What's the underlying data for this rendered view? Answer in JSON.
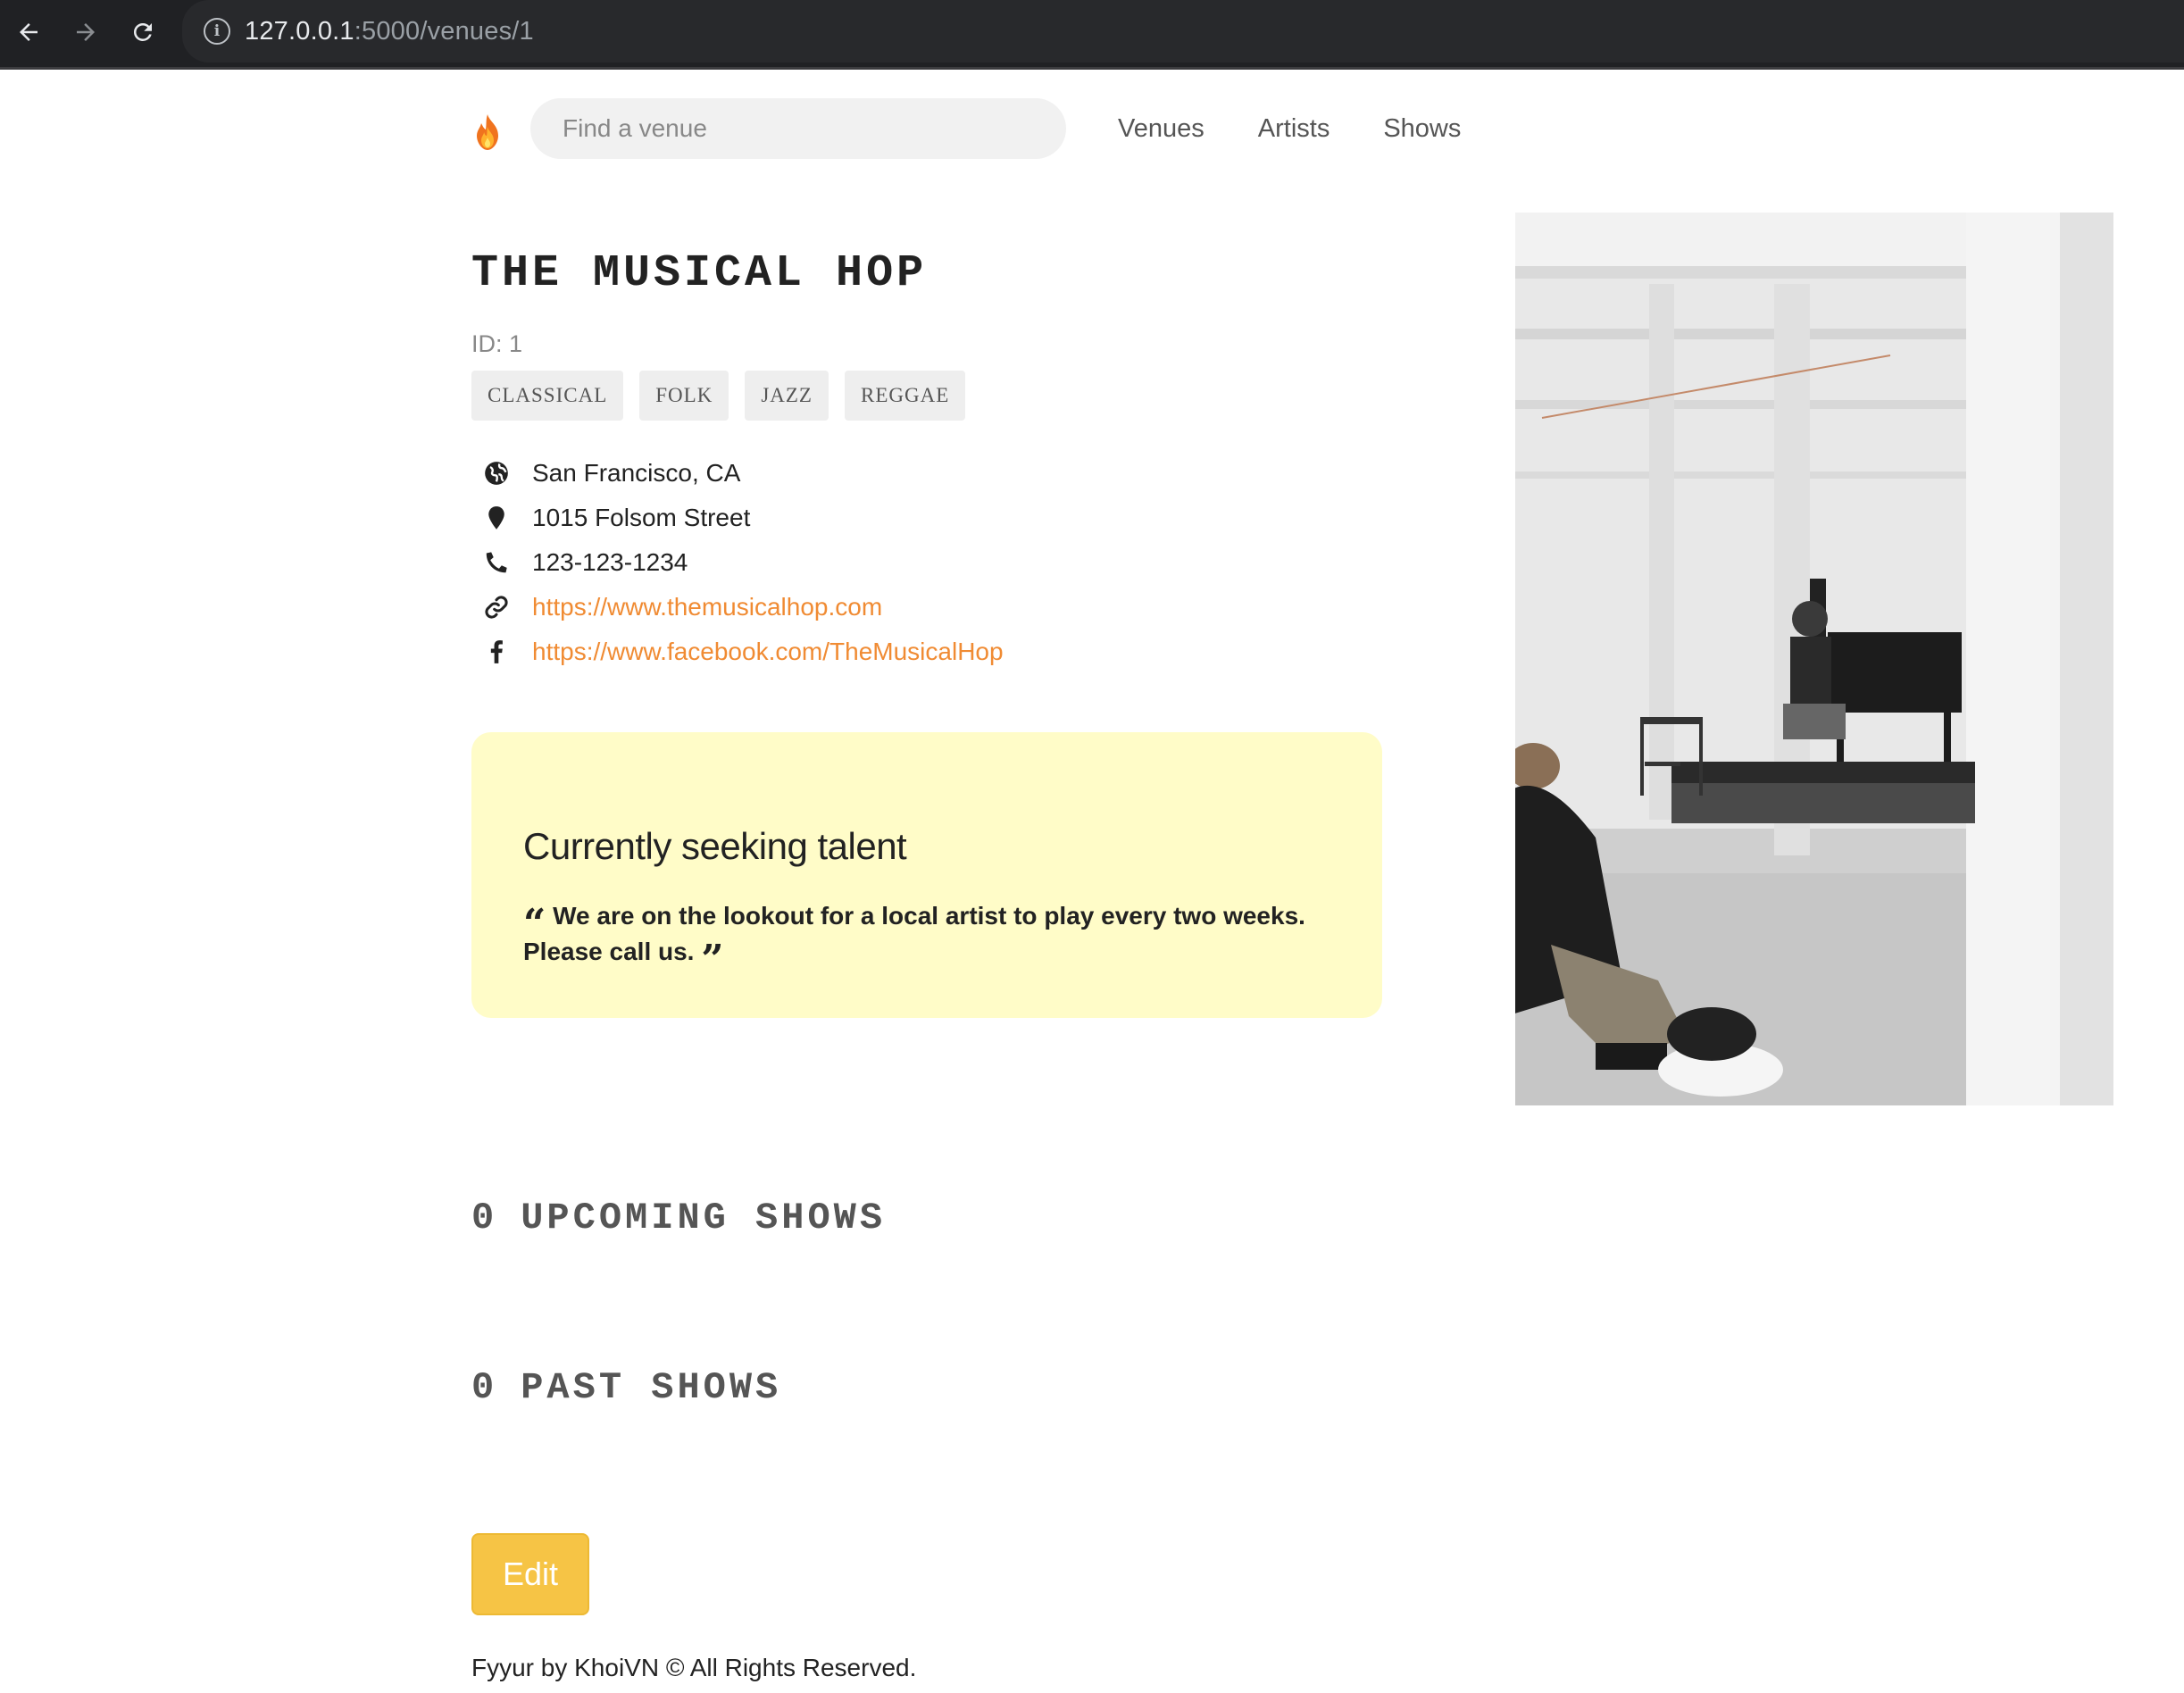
{
  "browser": {
    "url_host": "127.0.0.1",
    "url_rest": ":5000/venues/1",
    "info_glyph": "i"
  },
  "nav": {
    "search_placeholder": "Find a venue",
    "links": [
      "Venues",
      "Artists",
      "Shows"
    ],
    "logo_icon": "flame-icon"
  },
  "venue": {
    "name": "THE MUSICAL HOP",
    "id_text": "ID: 1",
    "genres": [
      "CLASSICAL",
      "FOLK",
      "JAZZ",
      "REGGAE"
    ],
    "city_state": "San Francisco, CA",
    "address": "1015 Folsom Street",
    "phone": "123-123-1234",
    "website": "https://www.themusicalhop.com",
    "facebook": "https://www.facebook.com/TheMusicalHop",
    "seeking_title": "Currently seeking talent",
    "seeking_description": "We are on the lookout for a local artist to play every two weeks. Please call us."
  },
  "shows": {
    "upcoming_count": "0",
    "upcoming_label": "UPCOMING SHOWS",
    "past_count": "0",
    "past_label": "PAST SHOWS"
  },
  "actions": {
    "edit_label": "Edit"
  },
  "footer": {
    "text": "Fyyur by KhoiVN © All Rights Reserved."
  },
  "colors": {
    "link": "#f08b33",
    "seeking_bg": "#fffcc8",
    "edit_bg": "#f6c445",
    "chrome_bg": "#202124"
  }
}
